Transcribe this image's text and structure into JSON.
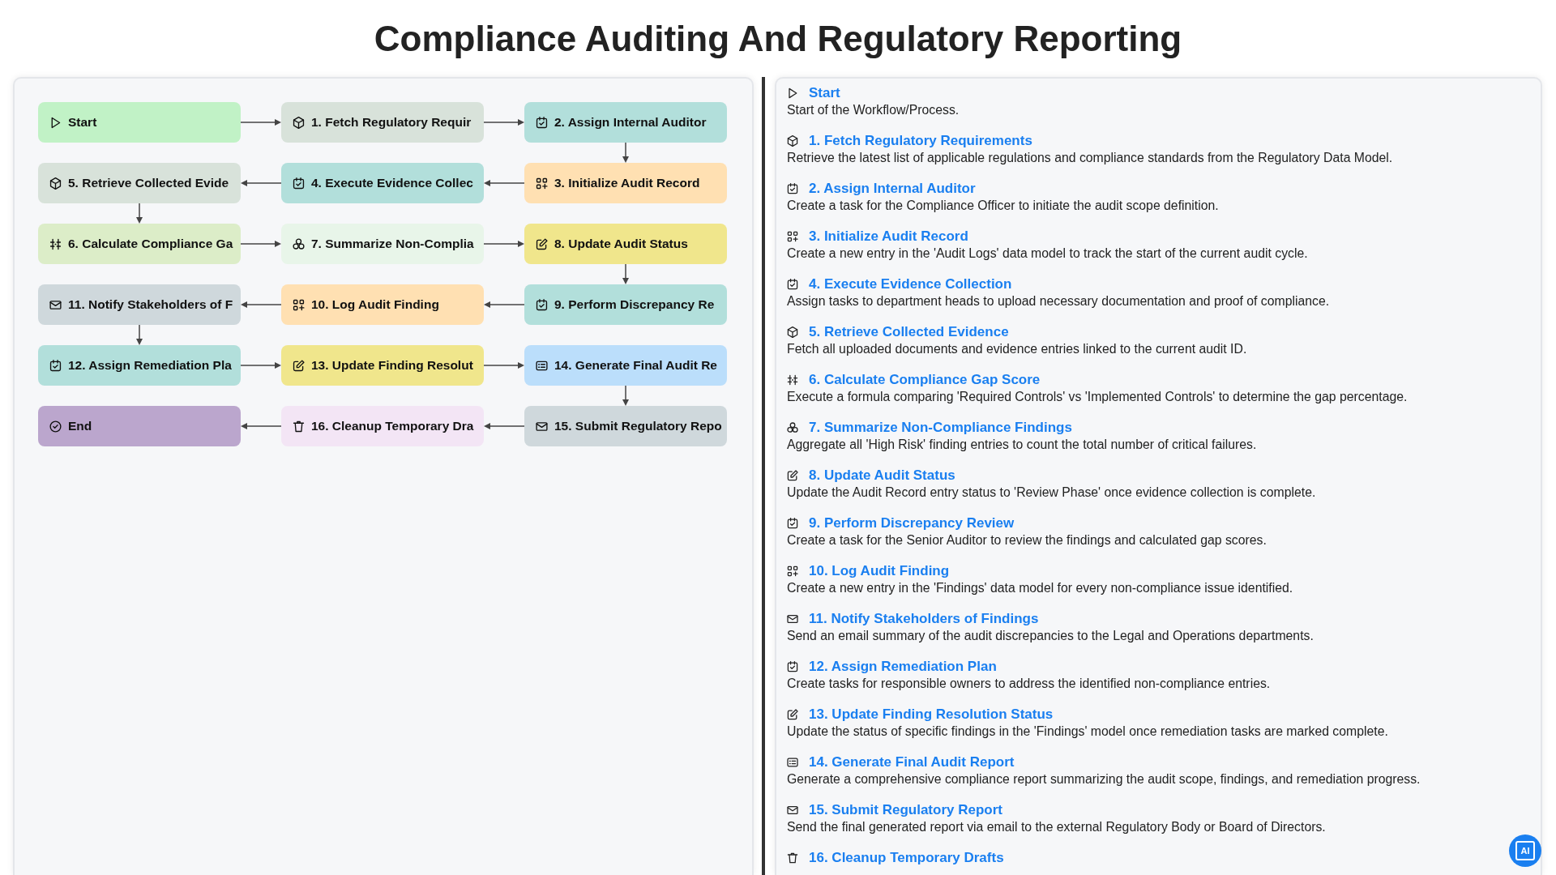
{
  "title": "Compliance Auditing And Regulatory Reporting",
  "flow_nodes": [
    {
      "label": "Start",
      "kind": "play",
      "color": "#c1f2c6"
    },
    {
      "label": "1. Fetch Regulatory Requir",
      "kind": "cube",
      "color": "#d8e2da"
    },
    {
      "label": "2. Assign Internal Auditor",
      "kind": "task",
      "color": "#b2dfdb"
    },
    {
      "label": "5. Retrieve Collected Evide",
      "kind": "cube",
      "color": "#d8e2da"
    },
    {
      "label": "4. Execute Evidence Collec",
      "kind": "task",
      "color": "#b2dfdb"
    },
    {
      "label": "3. Initialize Audit Record",
      "kind": "apps",
      "color": "#ffe0b2"
    },
    {
      "label": "6. Calculate Compliance Ga",
      "kind": "formula",
      "color": "#dcedc8"
    },
    {
      "label": "7. Summarize Non-Complia",
      "kind": "circles",
      "color": "#e8f5e9"
    },
    {
      "label": "8. Update Audit Status",
      "kind": "edit",
      "color": "#f0e68c"
    },
    {
      "label": "11. Notify Stakeholders of F",
      "kind": "mail",
      "color": "#cfd8dc"
    },
    {
      "label": "10. Log Audit Finding",
      "kind": "apps",
      "color": "#ffe0b2"
    },
    {
      "label": "9. Perform Discrepancy Re",
      "kind": "task",
      "color": "#b2dfdb"
    },
    {
      "label": "12. Assign Remediation Pla",
      "kind": "task",
      "color": "#b2dfdb"
    },
    {
      "label": "13. Update Finding Resolut",
      "kind": "edit",
      "color": "#f0e68c"
    },
    {
      "label": "14. Generate Final Audit Re",
      "kind": "list",
      "color": "#bbdefb"
    },
    {
      "label": "End",
      "kind": "check",
      "color": "#bba6cd"
    },
    {
      "label": "16. Cleanup Temporary Dra",
      "kind": "trash",
      "color": "#f3e5f5"
    },
    {
      "label": "15. Submit Regulatory Repo",
      "kind": "mail",
      "color": "#cfd8dc"
    }
  ],
  "steps": [
    {
      "title": "Start",
      "kind": "play",
      "description": "Start of the Workflow/Process."
    },
    {
      "title": "1. Fetch Regulatory Requirements",
      "kind": "cube",
      "description": "Retrieve the latest list of applicable regulations and compliance standards from the Regulatory Data Model."
    },
    {
      "title": "2. Assign Internal Auditor",
      "kind": "task",
      "description": "Create a task for the Compliance Officer to initiate the audit scope definition."
    },
    {
      "title": "3. Initialize Audit Record",
      "kind": "apps",
      "description": "Create a new entry in the 'Audit Logs' data model to track the start of the current audit cycle."
    },
    {
      "title": "4. Execute Evidence Collection",
      "kind": "task",
      "description": "Assign tasks to department heads to upload necessary documentation and proof of compliance."
    },
    {
      "title": "5. Retrieve Collected Evidence",
      "kind": "cube",
      "description": "Fetch all uploaded documents and evidence entries linked to the current audit ID."
    },
    {
      "title": "6. Calculate Compliance Gap Score",
      "kind": "formula",
      "description": "Execute a formula comparing 'Required Controls' vs 'Implemented Controls' to determine the gap percentage."
    },
    {
      "title": "7. Summarize Non-Compliance Findings",
      "kind": "circles",
      "description": "Aggregate all 'High Risk' finding entries to count the total number of critical failures."
    },
    {
      "title": "8. Update Audit Status",
      "kind": "edit",
      "description": "Update the Audit Record entry status to 'Review Phase' once evidence collection is complete."
    },
    {
      "title": "9. Perform Discrepancy Review",
      "kind": "task",
      "description": "Create a task for the Senior Auditor to review the findings and calculated gap scores."
    },
    {
      "title": "10. Log Audit Finding",
      "kind": "apps",
      "description": "Create a new entry in the 'Findings' data model for every non-compliance issue identified."
    },
    {
      "title": "11. Notify Stakeholders of Findings",
      "kind": "mail",
      "description": "Send an email summary of the audit discrepancies to the Legal and Operations departments."
    },
    {
      "title": "12. Assign Remediation Plan",
      "kind": "task",
      "description": "Create tasks for responsible owners to address the identified non-compliance entries."
    },
    {
      "title": "13. Update Finding Resolution Status",
      "kind": "edit",
      "description": "Update the status of specific findings in the 'Findings' model once remediation tasks are marked complete."
    },
    {
      "title": "14. Generate Final Audit Report",
      "kind": "list",
      "description": "Generate a comprehensive compliance report summarizing the audit scope, findings, and remediation progress."
    },
    {
      "title": "15. Submit Regulatory Report",
      "kind": "mail",
      "description": "Send the final generated report via email to the external Regulatory Body or Board of Directors."
    },
    {
      "title": "16. Cleanup Temporary Drafts",
      "kind": "trash"
    }
  ],
  "ai_button": {
    "label": "AI"
  }
}
